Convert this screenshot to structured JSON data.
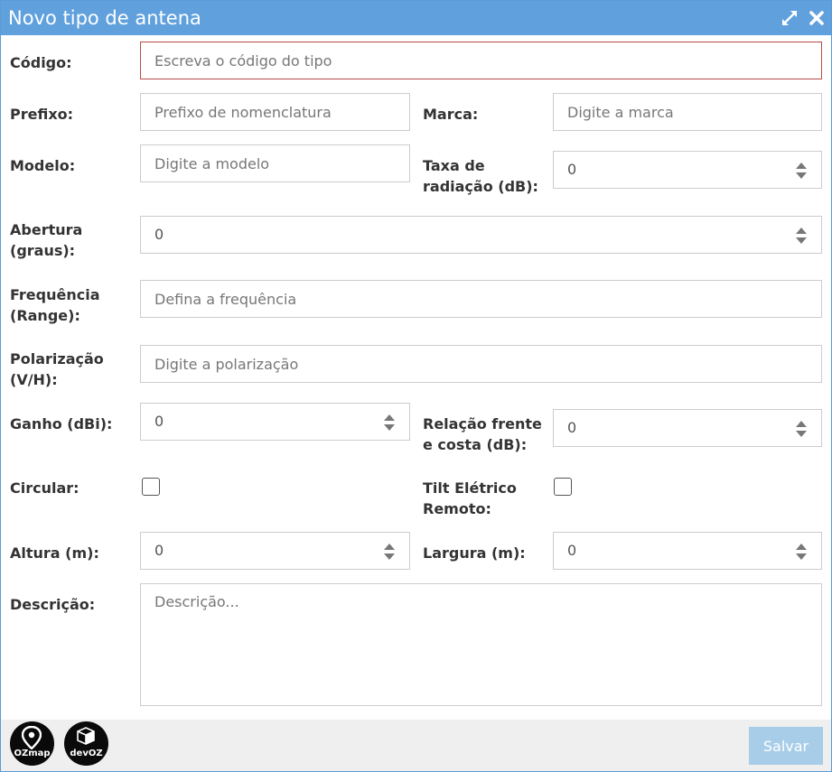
{
  "dialog": {
    "title": "Novo tipo de antena"
  },
  "fields": {
    "codigo": {
      "label": "Código:",
      "placeholder": "Escreva o código do tipo"
    },
    "prefixo": {
      "label": "Prefixo:",
      "placeholder": "Prefixo de nomenclatura"
    },
    "marca": {
      "label": "Marca:",
      "placeholder": "Digite a marca"
    },
    "modelo": {
      "label": "Modelo:",
      "placeholder": "Digite a modelo"
    },
    "taxa_radiacao": {
      "label_line1": "Taxa de",
      "label_line2": "radiação (dB):",
      "value": "0"
    },
    "abertura": {
      "label_line1": "Abertura",
      "label_line2": "(graus):",
      "value": "0"
    },
    "frequencia": {
      "label_line1": "Frequência",
      "label_line2": "(Range):",
      "placeholder": "Defina a frequência"
    },
    "polarizacao": {
      "label_line1": "Polarização",
      "label_line2": "(V/H):",
      "placeholder": "Digite a polarização"
    },
    "ganho": {
      "label": "Ganho (dBi):",
      "value": "0"
    },
    "relacao_frente_costa": {
      "label_line1": "Relação frente",
      "label_line2": "e costa (dB):",
      "value": "0"
    },
    "circular": {
      "label": "Circular:",
      "checked": false
    },
    "tilt_eletrico": {
      "label_line1": "Tilt Elétrico",
      "label_line2": "Remoto:",
      "checked": false
    },
    "altura": {
      "label": "Altura (m):",
      "value": "0"
    },
    "largura": {
      "label": "Largura (m):",
      "value": "0"
    },
    "descricao": {
      "label": "Descrição:",
      "placeholder": "Descrição..."
    }
  },
  "footer": {
    "logo_ozmap": "OZmap",
    "logo_devoz": "devOZ",
    "save_label": "Salvar"
  },
  "colors": {
    "titlebar": "#5fa0dd",
    "error_border": "#b94a48",
    "save_button": "#a8cde9",
    "footer_bg": "#efefef"
  },
  "icons": [
    "expand-icon",
    "close-icon",
    "spinner-icon",
    "map-pin-icon",
    "cube-icon"
  ]
}
